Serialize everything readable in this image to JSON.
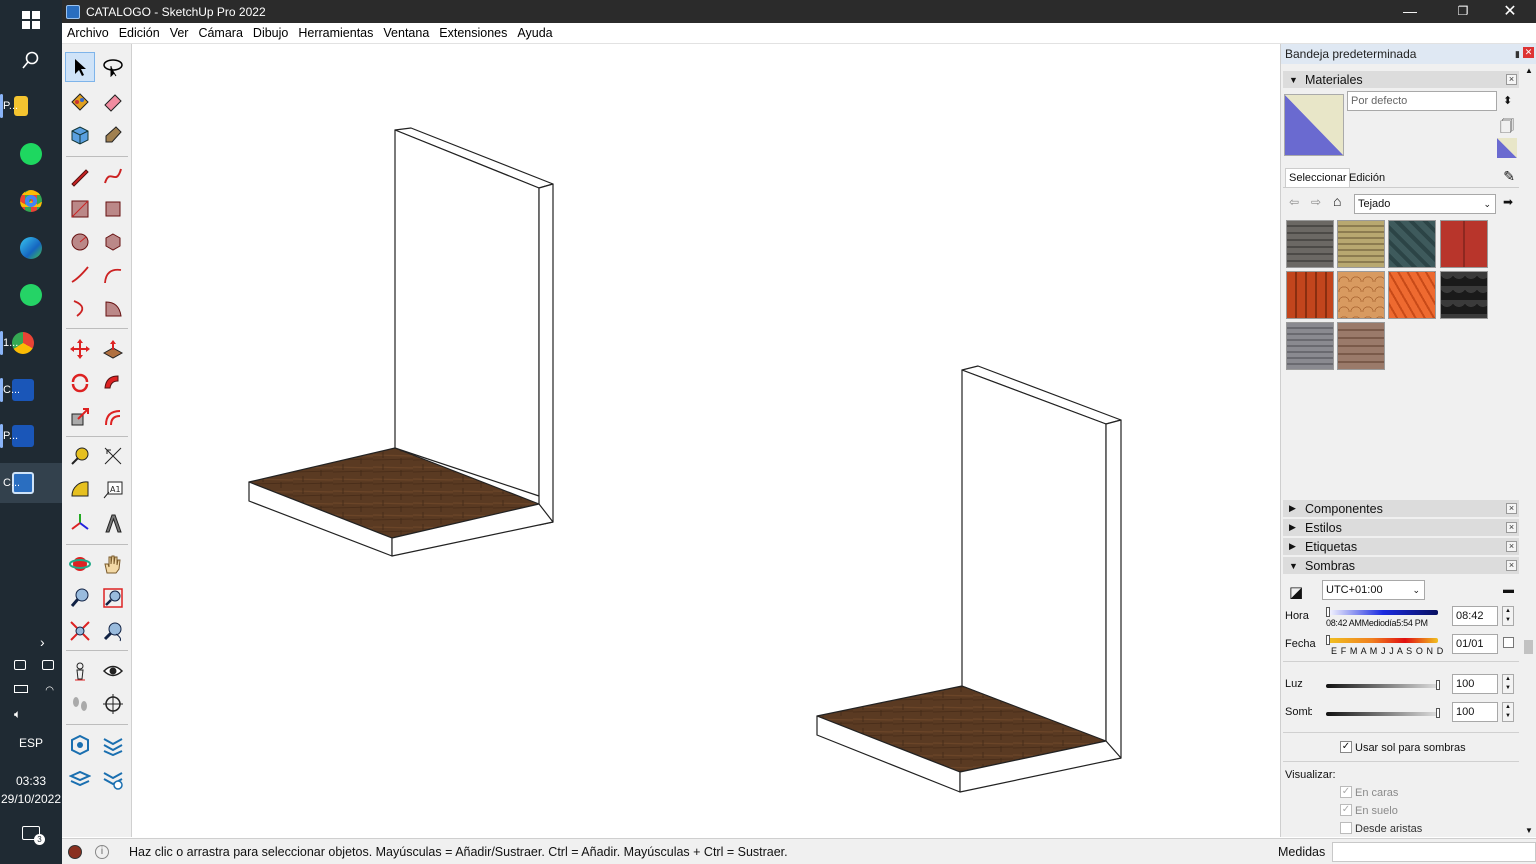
{
  "window": {
    "title": "CATALOGO - SketchUp Pro 2022"
  },
  "menu": [
    "Archivo",
    "Edición",
    "Ver",
    "Cámara",
    "Dibujo",
    "Herramientas",
    "Ventana",
    "Extensiones",
    "Ayuda"
  ],
  "taskbar": {
    "items": [
      {
        "icon": "folder-icon",
        "label": "P..."
      },
      {
        "icon": "spotify-icon",
        "label": ""
      },
      {
        "icon": "chrome-icon",
        "label": ""
      },
      {
        "icon": "edge-icon",
        "label": ""
      },
      {
        "icon": "whatsapp-icon",
        "label": ""
      },
      {
        "icon": "chrome-profile-icon",
        "label": "1..."
      },
      {
        "icon": "app-icon",
        "label": "C..."
      },
      {
        "icon": "app-icon",
        "label": "P..."
      },
      {
        "icon": "sketchup-icon",
        "label": "C..."
      }
    ],
    "lang": "ESP",
    "time": "03:33",
    "date": "29/10/2022",
    "notifications": "3"
  },
  "tray": {
    "title": "Bandeja predeterminada",
    "materiales": {
      "title": "Materiales",
      "current_name": "Por defecto",
      "tab_select": "Seleccionar",
      "tab_edit": "Edición",
      "collection": "Tejado"
    },
    "sections": [
      "Componentes",
      "Estilos",
      "Etiquetas",
      "Sombras"
    ],
    "sombras": {
      "timezone": "UTC+01:00",
      "hora_label": "Hora",
      "hora_value": "08:42",
      "hora_ticks": "08:42 AM",
      "hora_mid": "Mediodía",
      "hora_end": "5:54 PM",
      "fecha_label": "Fecha",
      "fecha_value": "01/01",
      "months": "E F M A M J J A S O N D",
      "luz_label": "Luz",
      "luz_value": "100",
      "sombra_label": "Sombra",
      "sombra_value": "100",
      "usar_sol": "Usar sol para sombras",
      "visualizar": "Visualizar:",
      "en_caras": "En caras",
      "en_suelo": "En suelo",
      "desde_aristas": "Desde aristas"
    }
  },
  "status": {
    "message": "Haz clic o arrastra para seleccionar objetos. Mayúsculas = Añadir/Sustraer. Ctrl = Añadir. Mayúsculas + Ctrl = Sustraer.",
    "medidas": "Medidas"
  },
  "colors": {
    "accent": "#2a6ec0",
    "wood": "#5a3a22",
    "taskbar": "#1f2a33"
  }
}
